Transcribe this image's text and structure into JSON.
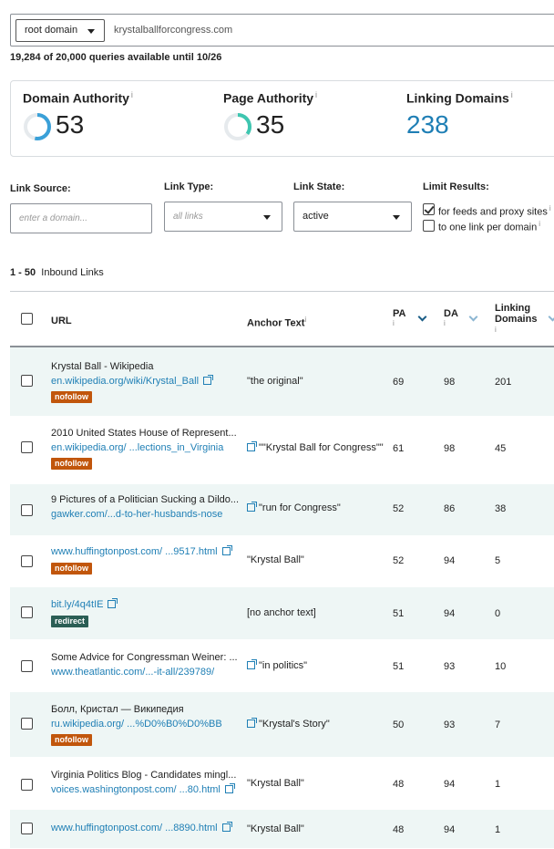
{
  "search": {
    "scope": "root domain",
    "query": "krystalballforcongress.com"
  },
  "quota_text": "19,284 of 20,000 queries available until 10/26",
  "metrics": [
    {
      "title": "Domain Authority",
      "value": "53",
      "fraction": 0.53,
      "ring_color": "#3aa0d8"
    },
    {
      "title": "Page Authority",
      "value": "35",
      "fraction": 0.35,
      "ring_color": "#3ec6b0"
    },
    {
      "title": "Linking Domains",
      "value": "238"
    }
  ],
  "info_glyph": "i",
  "filters": {
    "link_source_label": "Link Source:",
    "link_source_placeholder": "enter a domain...",
    "link_type_label": "Link Type:",
    "link_type_value": "all links",
    "link_state_label": "Link State:",
    "link_state_value": "active",
    "limit_label": "Limit Results:",
    "limit_options": [
      {
        "label": "for feeds and proxy sites",
        "checked": true
      },
      {
        "label": "to one link per domain",
        "checked": false
      }
    ]
  },
  "range": {
    "bold": "1 - 50",
    "text": "Inbound Links"
  },
  "table": {
    "headers": {
      "url": "URL",
      "anchor": "Anchor Text",
      "pa": "PA",
      "da": "DA",
      "ld1": "Linking",
      "ld2": "Domains"
    },
    "rows": [
      {
        "title": "Krystal Ball - Wikipedia",
        "url": "en.wikipedia.org/wiki/Krystal_Ball",
        "badge": "nofollow",
        "anchor": "\"the original\"",
        "pa": "69",
        "da": "98",
        "ld": "201"
      },
      {
        "title": "2010 United States House of Represent...",
        "url": "en.wikipedia.org/ ...lections_in_Virginia",
        "badge": "nofollow",
        "anchor": "\"\"Krystal Ball for Congress\"\"",
        "pa": "61",
        "da": "98",
        "ld": "45"
      },
      {
        "title": "9 Pictures of a Politician Sucking a Dildo...",
        "url": "gawker.com/...d-to-her-husbands-nose",
        "badge": "",
        "anchor": "\"run for Congress\"",
        "pa": "52",
        "da": "86",
        "ld": "38"
      },
      {
        "title": "",
        "url": "www.huffingtonpost.com/ ...9517.html",
        "badge": "nofollow",
        "anchor": "\"Krystal Ball\"",
        "pa": "52",
        "da": "94",
        "ld": "5"
      },
      {
        "title": "",
        "url": "bit.ly/4q4tIE",
        "badge": "redirect",
        "anchor": "[no anchor text]",
        "pa": "51",
        "da": "94",
        "ld": "0"
      },
      {
        "title": "Some Advice for Congressman Weiner: ...",
        "url": "www.theatlantic.com/...-it-all/239789/",
        "badge": "",
        "anchor": "\"in politics\"",
        "pa": "51",
        "da": "93",
        "ld": "10"
      },
      {
        "title": "Болл, Кристал — Википедия",
        "url": "ru.wikipedia.org/ ...%D0%B0%D0%BB",
        "badge": "nofollow",
        "anchor": "\"Krystal's Story\"",
        "pa": "50",
        "da": "93",
        "ld": "7"
      },
      {
        "title": "Virginia Politics Blog - Candidates mingl...",
        "url": "voices.washingtonpost.com/ ...80.html",
        "badge": "",
        "anchor": "\"Krystal Ball\"",
        "pa": "48",
        "da": "94",
        "ld": "1"
      },
      {
        "title": "",
        "url": "www.huffingtonpost.com/ ...8890.html",
        "badge": "",
        "anchor": "\"Krystal Ball\"",
        "pa": "48",
        "da": "94",
        "ld": "1"
      }
    ]
  }
}
